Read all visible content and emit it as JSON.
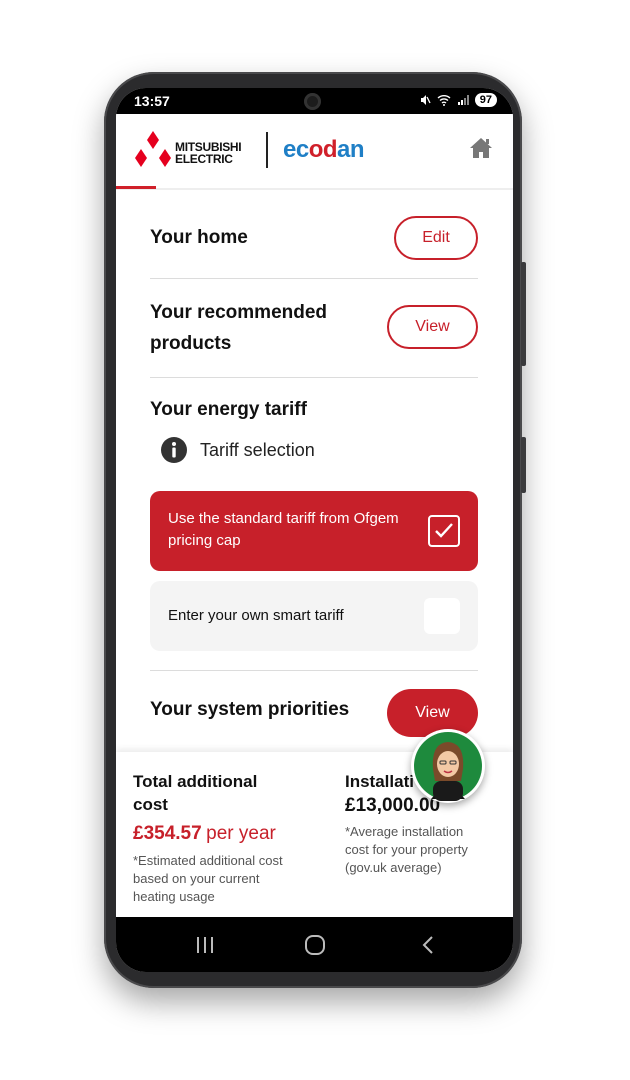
{
  "status_bar": {
    "time": "13:57",
    "battery": "97",
    "icons": [
      "mute-icon",
      "wifi-icon",
      "signal-icon"
    ]
  },
  "header": {
    "brand_line1": "MITSUBISHI",
    "brand_line2": "ELECTRIC",
    "product_logo": "ecodan",
    "home_icon": "home-icon"
  },
  "colors": {
    "accent": "#c7202a",
    "ecodan_blue": "#1f7fc6",
    "ecodan_red": "#d0202a",
    "option_inactive_bg": "#f4f4f4"
  },
  "sections": {
    "home": {
      "title": "Your home",
      "button": "Edit"
    },
    "products": {
      "title_line1": "Your recommended",
      "title_line2": "products",
      "button": "View"
    },
    "tariff": {
      "title": "Your energy tariff",
      "info_label": "Tariff selection",
      "options": [
        {
          "line1": "Use the standard tariff from Ofgem",
          "line2": "pricing cap",
          "selected": true
        },
        {
          "line1": "Enter your own smart tariff",
          "selected": false
        }
      ]
    },
    "priorities": {
      "title": "Your system priorities",
      "button": "View"
    }
  },
  "footer": {
    "left": {
      "title_line1": "Total additional",
      "title_line2": "cost",
      "price": "£354.57",
      "per": "per year",
      "note_line1": "*Estimated additional cost",
      "note_line2": "based on your current",
      "note_line3": "heating usage"
    },
    "right": {
      "title": "Installati",
      "price": "£13,000.00",
      "note_line1": "*Average installation",
      "note_line2": "cost for your property",
      "note_line3": "(gov.uk average)"
    }
  },
  "navbar": {
    "icons": [
      "recent-apps-icon",
      "home-nav-icon",
      "back-icon"
    ]
  }
}
